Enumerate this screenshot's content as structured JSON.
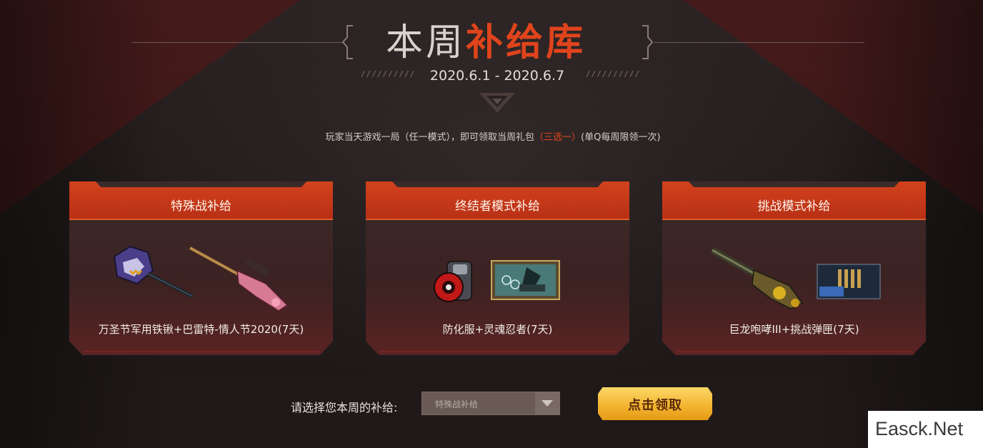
{
  "header": {
    "title_plain": "本周",
    "title_highlight": "补给库",
    "date_range": "2020.6.1 - 2020.6.7",
    "slashes": "//////////"
  },
  "notice": {
    "prefix": "玩家当天游戏一局（任一模式），即可领取当周礼包",
    "highlight": "（三选一）",
    "suffix": "(单Q每周限领一次)"
  },
  "cards": [
    {
      "title": "特殊战补给",
      "description": "万圣节军用铁锹+巴雷特-情人节2020(7天)",
      "icons": [
        "shovel-icon",
        "sniper-rifle-icon"
      ]
    },
    {
      "title": "终结者模式补给",
      "description": "防化服+灵魂忍者(7天)",
      "icons": [
        "hazmat-suit-icon",
        "soul-ninja-card-icon"
      ]
    },
    {
      "title": "挑战模式补给",
      "description": "巨龙咆哮III+挑战弹匣(7天)",
      "icons": [
        "gatling-gun-icon",
        "ammo-magazine-icon"
      ]
    }
  ],
  "selector": {
    "label": "请选择您本周的补给:",
    "value": "特殊战补给"
  },
  "claim_button": "点击领取",
  "watermark": "Easck.Net",
  "colors": {
    "accent": "#e0441c",
    "card_header": "#c7381a",
    "button": "#f4b531",
    "background": "#231d1d"
  }
}
